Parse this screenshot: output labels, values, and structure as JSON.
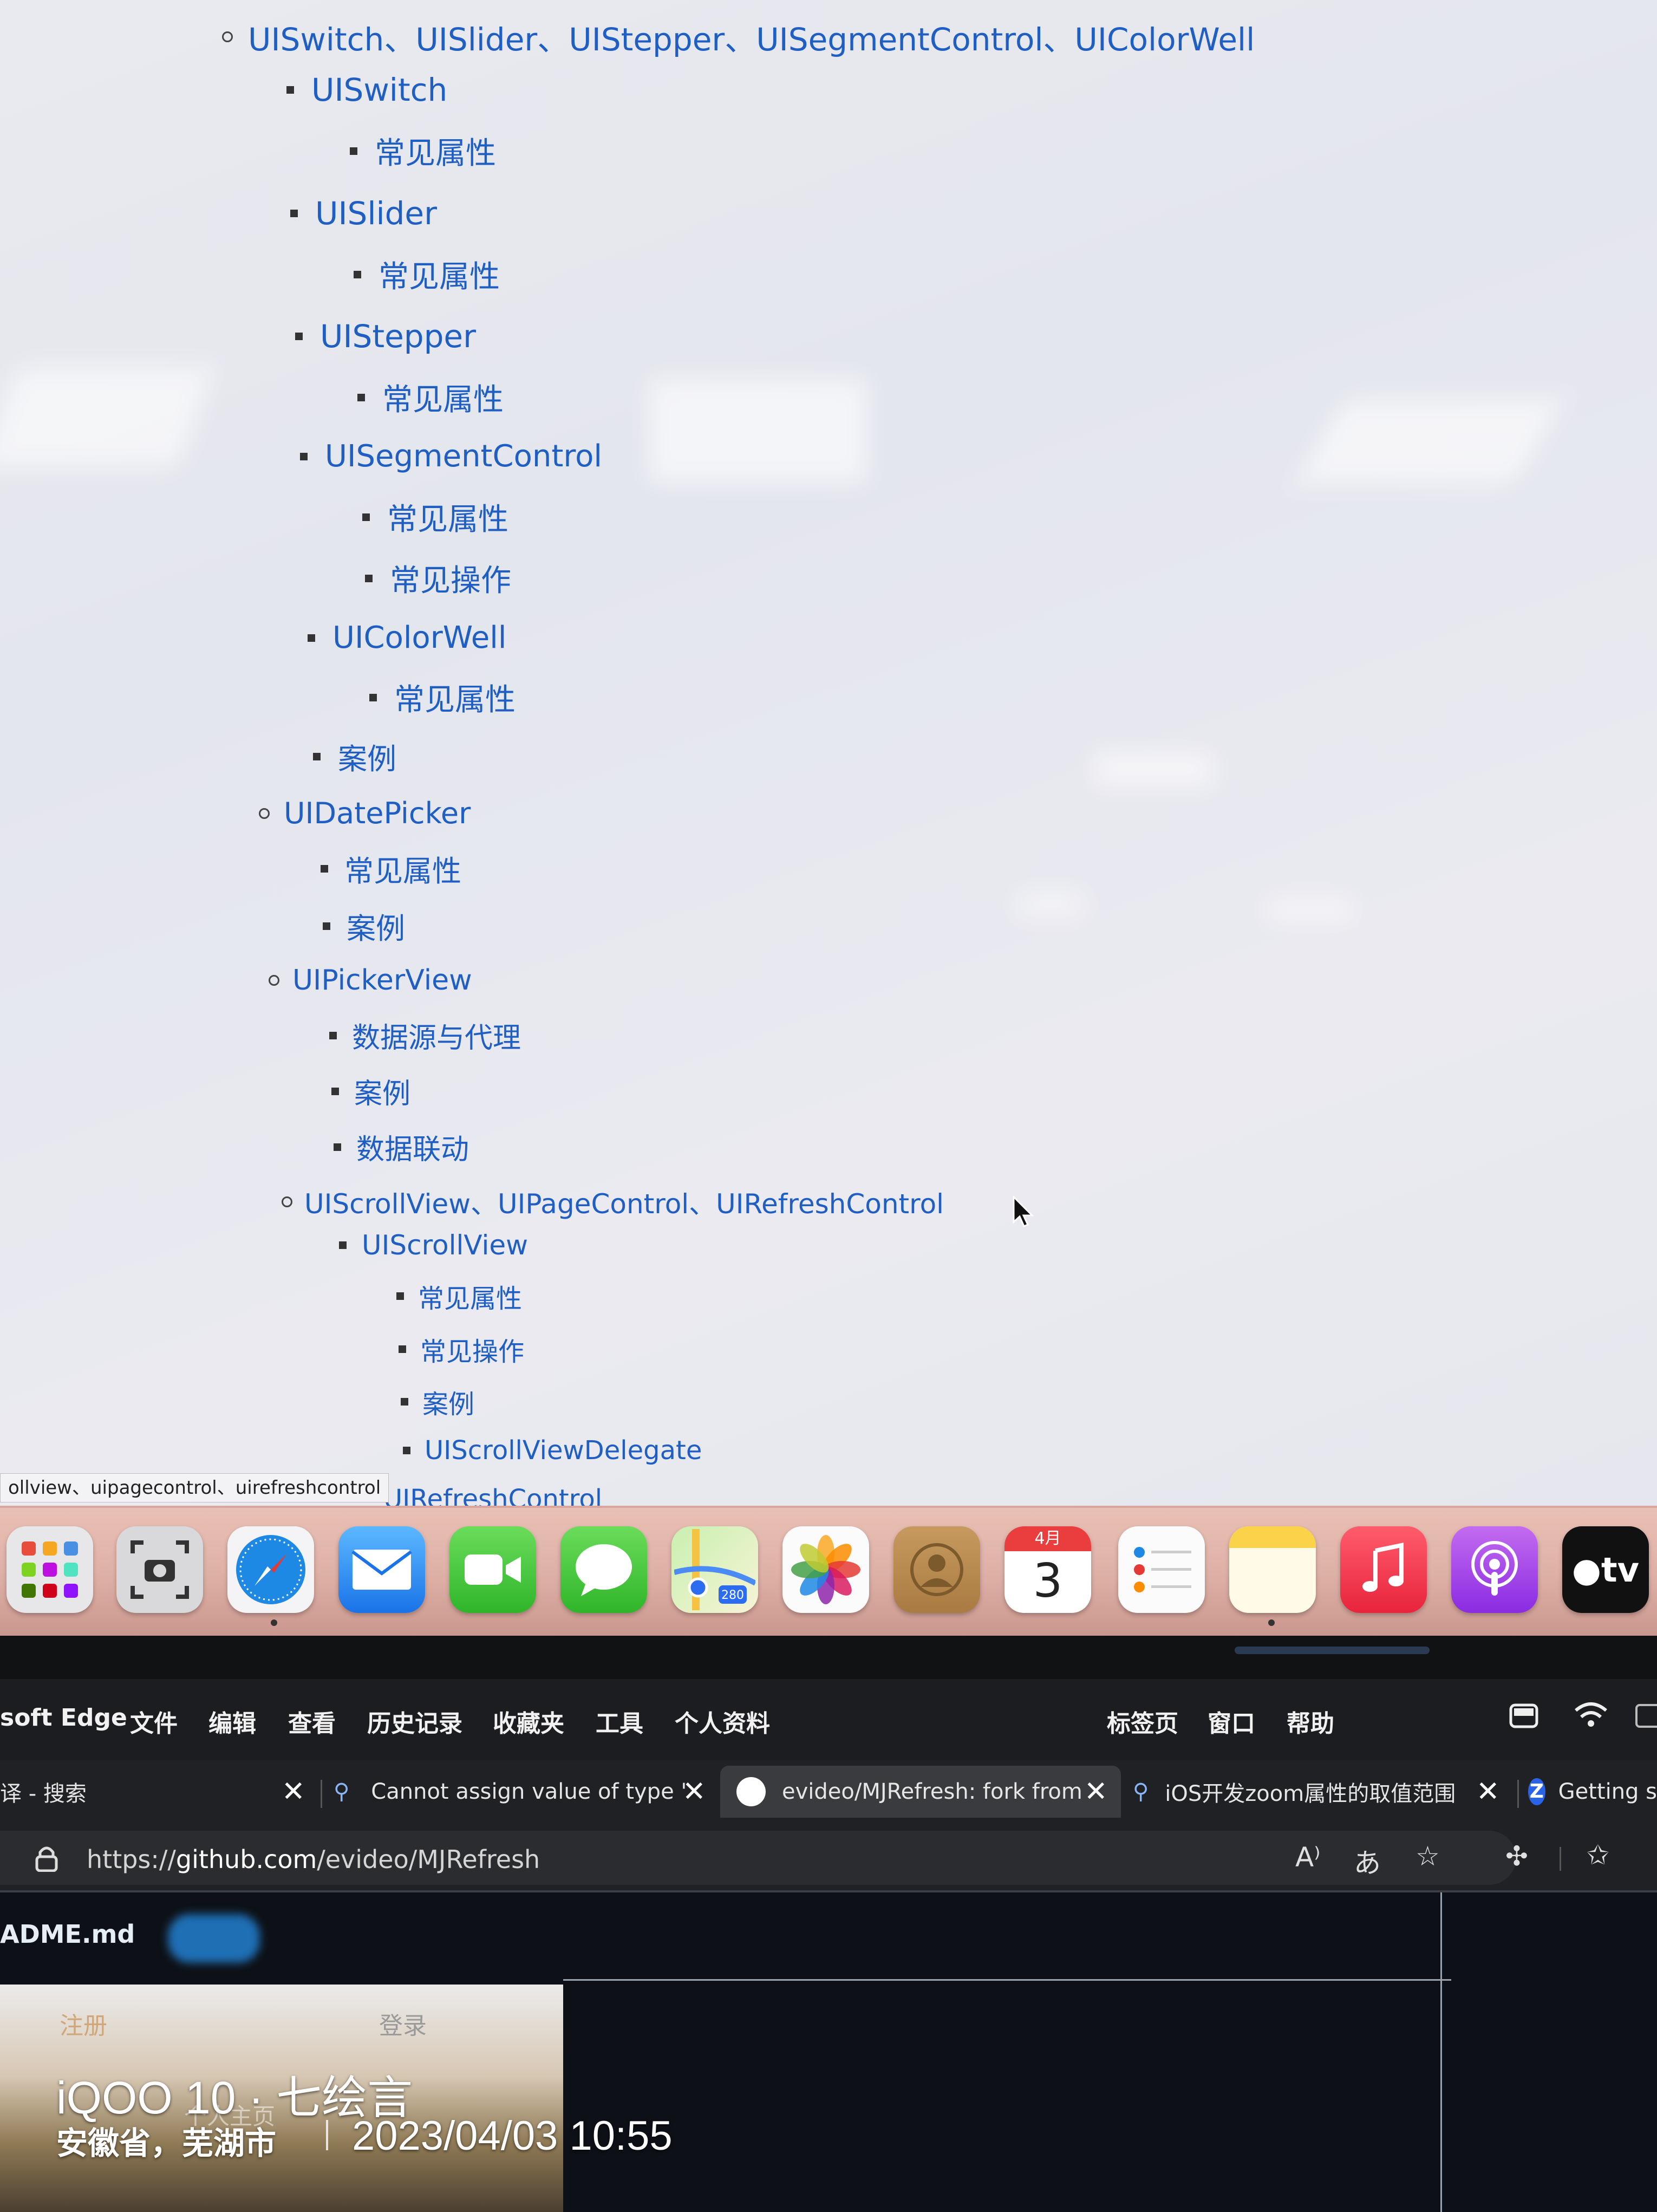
{
  "toc": {
    "items": [
      {
        "text": "UISwitch、UISlider、UIStepper、UISegmentControl、UIColorWell",
        "level": 1
      },
      {
        "text": "UISwitch",
        "level": 2
      },
      {
        "text": "常见属性",
        "level": 3
      },
      {
        "text": "UISlider",
        "level": 2
      },
      {
        "text": "常见属性",
        "level": 3
      },
      {
        "text": "UIStepper",
        "level": 2
      },
      {
        "text": "常见属性",
        "level": 3
      },
      {
        "text": "UISegmentControl",
        "level": 2
      },
      {
        "text": "常见属性",
        "level": 3
      },
      {
        "text": "常见操作",
        "level": 3
      },
      {
        "text": "UIColorWell",
        "level": 2
      },
      {
        "text": "常见属性",
        "level": 3
      },
      {
        "text": "案例",
        "level": 2
      },
      {
        "text": "UIDatePicker",
        "level": 1
      },
      {
        "text": "常见属性",
        "level": 2
      },
      {
        "text": "案例",
        "level": 2
      },
      {
        "text": "UIPickerView",
        "level": 1
      },
      {
        "text": "数据源与代理",
        "level": 2
      },
      {
        "text": "案例",
        "level": 2
      },
      {
        "text": "数据联动",
        "level": 2
      },
      {
        "text": "UIScrollView、UIPageControl、UIRefreshControl",
        "level": 1
      },
      {
        "text": "UIScrollView",
        "level": 2
      },
      {
        "text": "常见属性",
        "level": 3
      },
      {
        "text": "常见操作",
        "level": 3
      },
      {
        "text": "案例",
        "level": 3
      },
      {
        "text": "UIScrollViewDelegate",
        "level": 3
      },
      {
        "text": "UIRefreshControl",
        "level": 2
      }
    ],
    "tooltip": "ollview、uipagecontrol、uirefreshcontrol"
  },
  "dock": {
    "icons": [
      "launchpad-icon",
      "screenshot-icon",
      "safari-icon",
      "mail-icon",
      "facetime-icon",
      "messages-icon",
      "maps-icon",
      "photos-icon",
      "contacts-icon",
      "calendar-icon",
      "reminders-icon",
      "notes-icon",
      "music-icon",
      "podcasts-icon",
      "apple-tv-icon"
    ],
    "calendar_month": "4月",
    "calendar_day": "3",
    "maps_badge": "280",
    "tv_label": "tv"
  },
  "menubar": {
    "app_name": "soft Edge",
    "items": [
      "文件",
      "编辑",
      "查看",
      "历史记录",
      "收藏夹",
      "工具",
      "个人资料"
    ],
    "right_items": [
      "标签页",
      "窗口",
      "帮助"
    ]
  },
  "tabs": [
    {
      "title": "译 - 搜索",
      "icon": ""
    },
    {
      "title": "Cannot assign value of type '",
      "icon": "search-icon"
    },
    {
      "title": "evideo/MJRefresh: fork from",
      "icon": "github-icon",
      "active": true
    },
    {
      "title": "iOS开发zoom属性的取值范围",
      "icon": "search-icon"
    },
    {
      "title": "Getting s",
      "icon": "z-icon"
    }
  ],
  "address": {
    "prefix": "https://",
    "host": "github.com",
    "path": "/evideo/MJRefresh",
    "read_aloud": "A",
    "translate": "あ"
  },
  "content": {
    "file_title": "ADME.md",
    "panel_tabs": [
      "注册",
      "登录"
    ],
    "panel_caption": "个人主页"
  },
  "watermark": {
    "line1": "iQOO 10 · 七绘言",
    "line2_location": "安徽省，芜湖市",
    "line2_datetime": "2023/04/03 10:55"
  },
  "colors": {
    "link": "#1f5fc4",
    "page_bg": "#e8e9ef",
    "dock_bg": "#deb1a7",
    "chrome_bg": "#202124"
  }
}
